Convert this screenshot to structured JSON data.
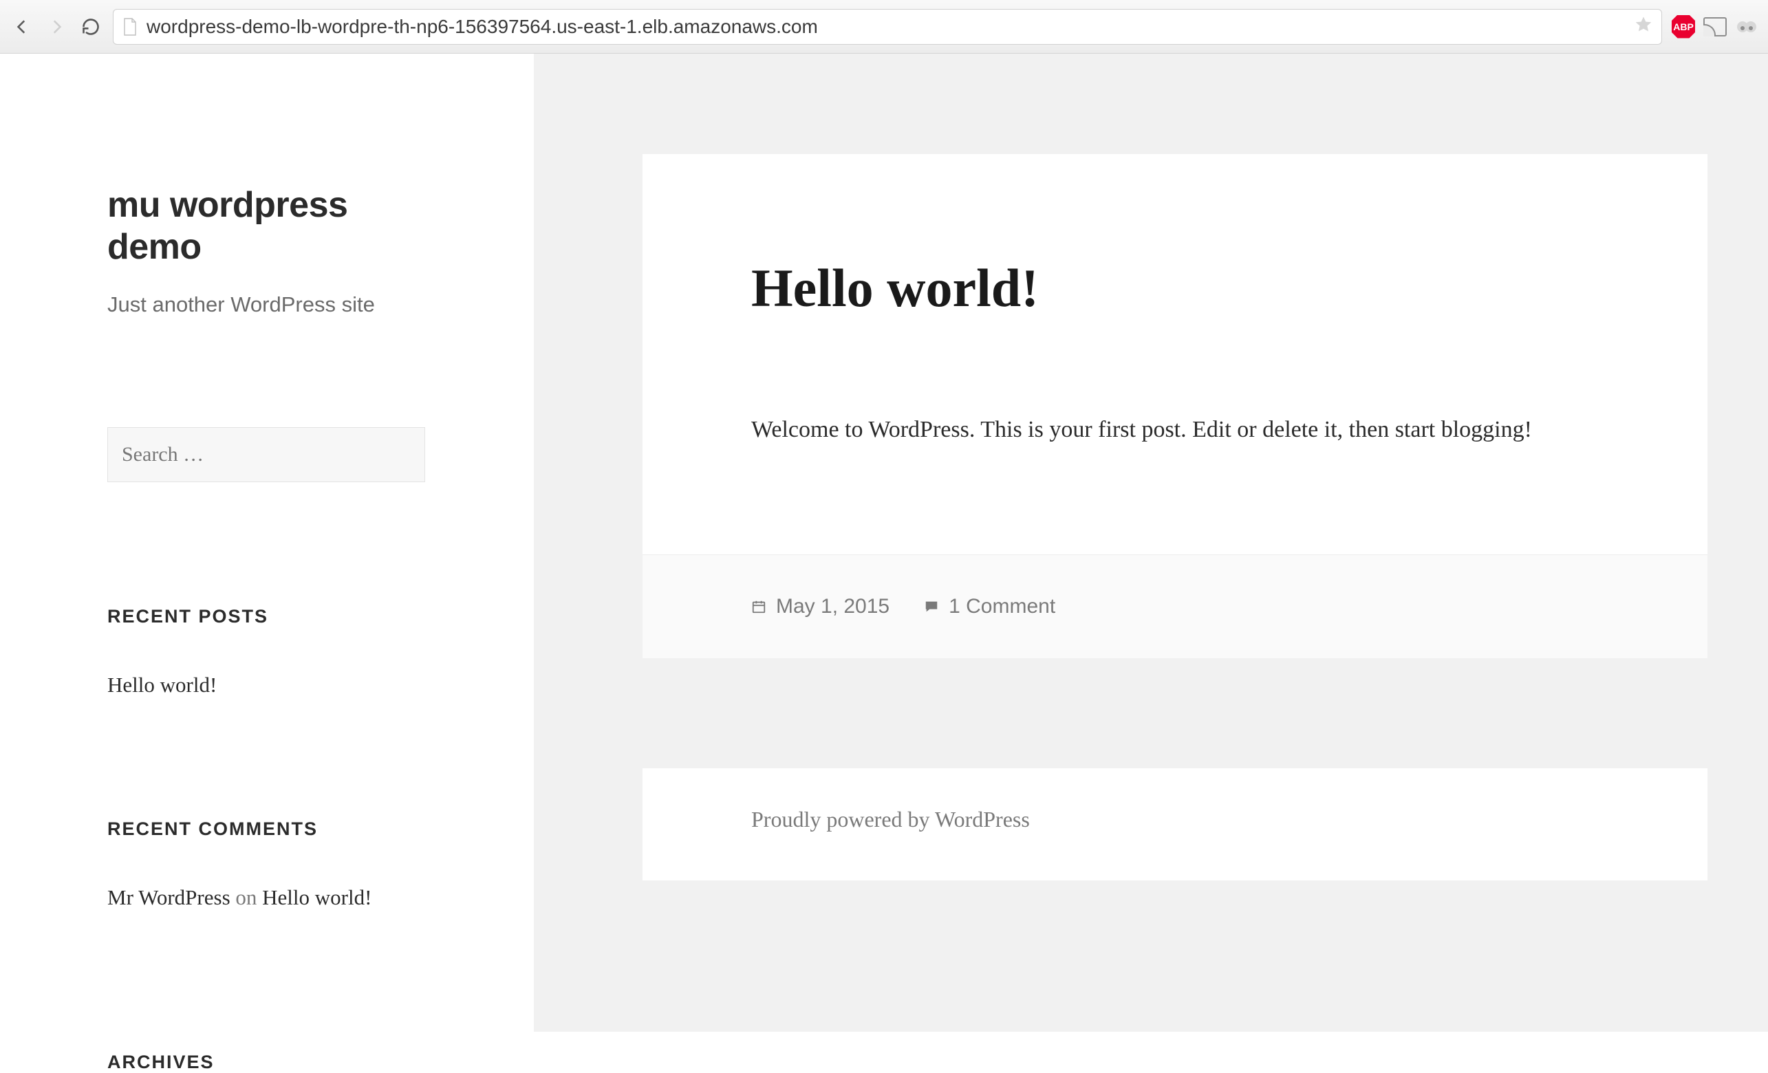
{
  "browser": {
    "url": "wordpress-demo-lb-wordpre-th-np6-156397564.us-east-1.elb.amazonaws.com",
    "abp_label": "ABP"
  },
  "sidebar": {
    "site_title": "mu wordpress demo",
    "tagline": "Just another WordPress site",
    "search_placeholder": "Search …",
    "widgets": {
      "recent_posts_title": "RECENT POSTS",
      "recent_posts": [
        "Hello world!"
      ],
      "recent_comments_title": "RECENT COMMENTS",
      "recent_comments": [
        {
          "author": "Mr WordPress",
          "connector": "on",
          "post": "Hello world!"
        }
      ],
      "archives_title": "ARCHIVES"
    }
  },
  "post": {
    "title": "Hello world!",
    "content": "Welcome to WordPress. This is your first post. Edit or delete it, then start blogging!",
    "date": "May 1, 2015",
    "comments": "1 Comment"
  },
  "footer": {
    "text": "Proudly powered by WordPress"
  }
}
